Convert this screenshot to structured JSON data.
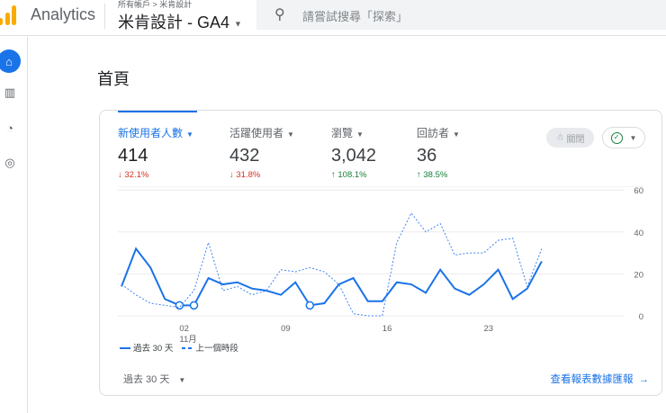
{
  "header": {
    "app_name": "Analytics",
    "breadcrumb": "所有帳戶 > 米肯設計",
    "property": "米肯設計 - GA4",
    "search_placeholder": "請嘗試搜尋「探索」"
  },
  "rail": {
    "icons": [
      "home-icon",
      "reports-icon",
      "explore-icon",
      "advertising-icon"
    ]
  },
  "page": {
    "title": "首頁"
  },
  "metrics": [
    {
      "label": "新使用者人數",
      "value": "414",
      "change": "↓ 32.1%",
      "direction": "down",
      "selected": true
    },
    {
      "label": "活躍使用者",
      "value": "432",
      "change": "↓ 31.8%",
      "direction": "down"
    },
    {
      "label": "瀏覽",
      "value": "3,042",
      "change": "↑ 108.1%",
      "direction": "up"
    },
    {
      "label": "回訪者",
      "value": "36",
      "change": "↑ 38.5%",
      "direction": "up"
    }
  ],
  "insights_label": "關閉",
  "legend": {
    "current": "過去 30 天",
    "previous": "上一個時段"
  },
  "footer": {
    "range": "過去 30 天",
    "link": "查看報表數據匯報"
  },
  "colors": {
    "accent": "#1a73e8",
    "down": "#d93025",
    "up": "#188038"
  },
  "chart_data": {
    "type": "line",
    "x_ticks": [
      {
        "index": 4,
        "label": "02",
        "sub": "11月"
      },
      {
        "index": 11,
        "label": "09"
      },
      {
        "index": 18,
        "label": "16"
      },
      {
        "index": 25,
        "label": "23"
      }
    ],
    "y_ticks": [
      "0",
      "20",
      "40",
      "60"
    ],
    "ylim": [
      0,
      60
    ],
    "series": [
      {
        "name": "過去 30 天",
        "style": "solid",
        "values": [
          14,
          32,
          23,
          8,
          5,
          5,
          18,
          15,
          16,
          13,
          12,
          10,
          16,
          5,
          6,
          15,
          18,
          7,
          7,
          16,
          15,
          11,
          22,
          13,
          10,
          15,
          22,
          8,
          13,
          26
        ],
        "markers": [
          4,
          5,
          13
        ]
      },
      {
        "name": "上一個時段",
        "style": "dashed",
        "values": [
          15,
          10,
          6,
          5,
          4,
          12,
          35,
          12,
          14,
          10,
          12,
          22,
          21,
          23,
          21,
          15,
          1,
          0,
          0,
          35,
          49,
          40,
          44,
          29,
          30,
          30,
          36,
          37,
          14,
          32
        ]
      }
    ]
  }
}
